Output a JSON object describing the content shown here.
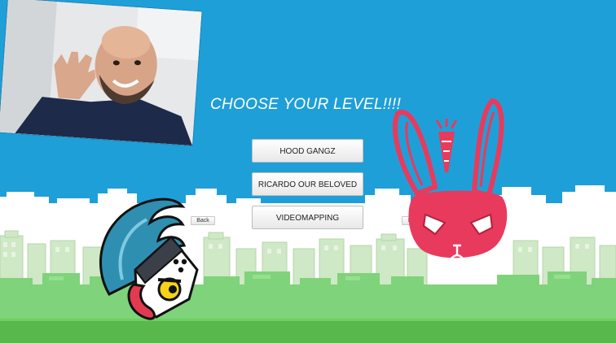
{
  "screen": {
    "title": "CHOOSE YOUR LEVEL!!!!"
  },
  "levels": [
    {
      "label": "HOOD GANGZ"
    },
    {
      "label": "RICARDO OUR BELOVED"
    },
    {
      "label": "VIDEOMAPPING"
    }
  ],
  "nav": {
    "back_label": "Back",
    "next_label": "Next"
  },
  "colors": {
    "sky": "#1f9fd8",
    "clouds": "#ffffff",
    "buildings": "#cfe8c6",
    "bushes": "#7fd37a",
    "ground": "#58b84b",
    "bunny": "#e83a5c",
    "bird_crest": "#2f8fb0"
  },
  "icons": [
    "webcam-photo",
    "bird-character-icon",
    "bunny-character-icon",
    "carrot-icon"
  ]
}
